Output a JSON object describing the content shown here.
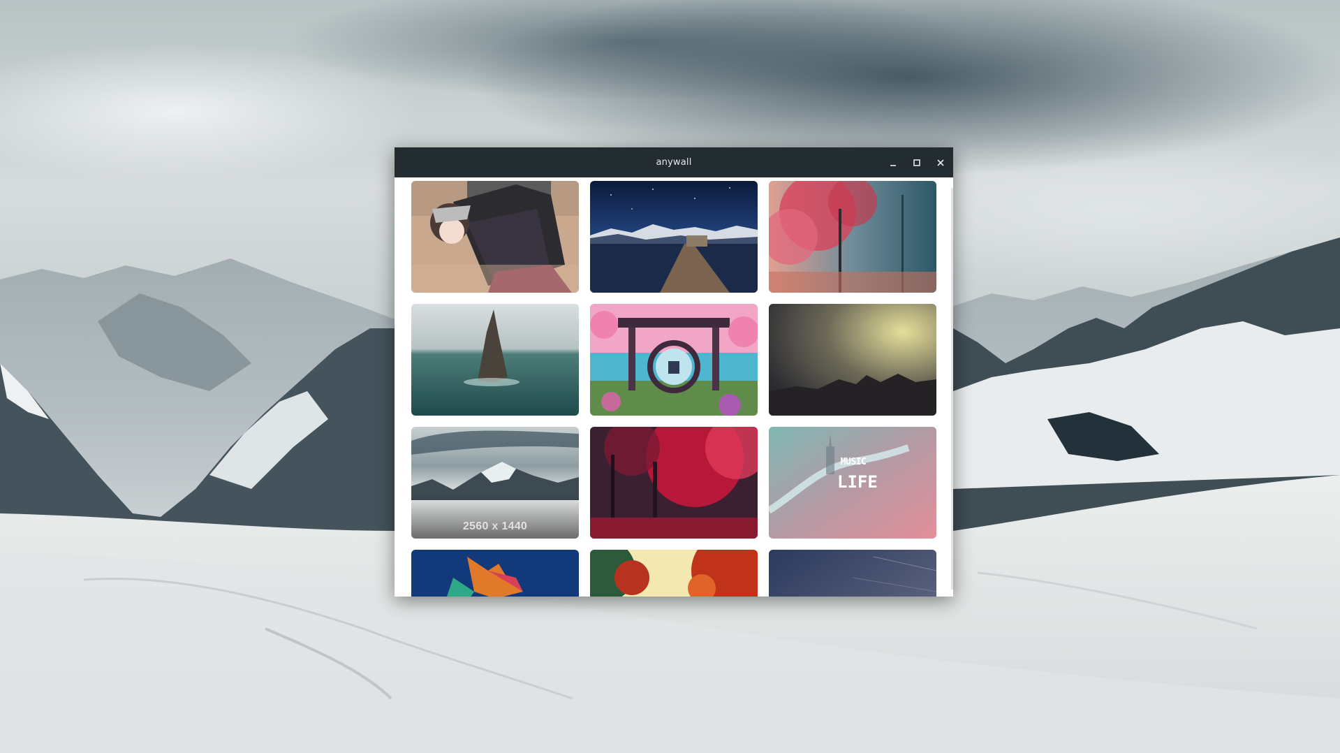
{
  "window": {
    "title": "anywall",
    "controls": {
      "minimize_icon": "minimize-icon",
      "maximize_icon": "maximize-icon",
      "close_icon": "close-icon"
    }
  },
  "wallpapers": [
    {
      "subject": "anime-girl"
    },
    {
      "subject": "night-lake-pier"
    },
    {
      "subject": "red-tree-forest"
    },
    {
      "subject": "ocean-rock"
    },
    {
      "subject": "pixel-torii-gate"
    },
    {
      "subject": "dusk-mountains"
    },
    {
      "subject": "snowy-mountains",
      "hover_label": "2560 x 1440"
    },
    {
      "subject": "crimson-forest"
    },
    {
      "subject": "city-river-music-life",
      "overlay_text": [
        "MUSIC",
        "LIFE"
      ]
    },
    {
      "subject": "low-poly-shape"
    },
    {
      "subject": "autumn-trees"
    },
    {
      "subject": "dark-blue-sky"
    }
  ],
  "colors": {
    "titlebar": "#232c30",
    "title_text": "#e6e9ea",
    "window_bg": "#ffffff"
  }
}
